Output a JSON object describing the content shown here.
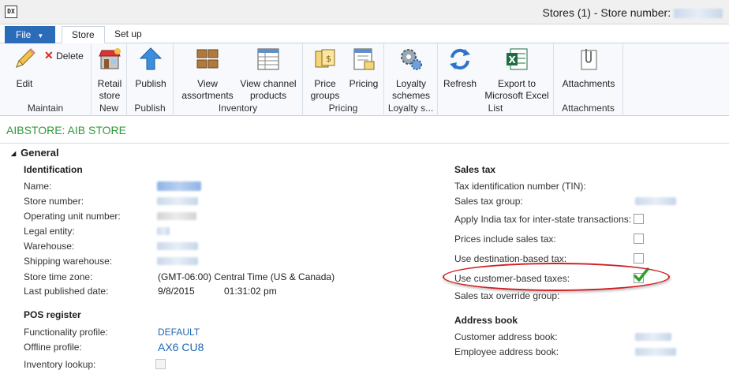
{
  "window": {
    "title": "Stores (1) - Store number:",
    "title_redacted": "AIB STORE"
  },
  "tabs": {
    "file": "File",
    "store": "Store",
    "setup": "Set up"
  },
  "ribbon": {
    "maintain": {
      "label": "Maintain",
      "edit": "Edit",
      "delete": "Delete"
    },
    "new": {
      "label": "New",
      "retail_store": [
        "Retail",
        "store"
      ]
    },
    "publish": {
      "label": "Publish",
      "publish": "Publish"
    },
    "inventory": {
      "label": "Inventory",
      "view_assortments": [
        "View",
        "assortments"
      ],
      "view_channel_products": [
        "View channel",
        "products"
      ]
    },
    "pricing": {
      "label": "Pricing",
      "price_groups": [
        "Price",
        "groups"
      ],
      "pricing": "Pricing"
    },
    "loyalty": {
      "label": "Loyalty s...",
      "loyalty_schemes": [
        "Loyalty",
        "schemes"
      ]
    },
    "list": {
      "label": "List",
      "refresh": "Refresh",
      "export": [
        "Export to",
        "Microsoft Excel"
      ]
    },
    "attachments": {
      "label": "Attachments",
      "attachments": "Attachments"
    }
  },
  "form": {
    "title": "AIBSTORE: AIB STORE",
    "general": "General",
    "identification": {
      "header": "Identification",
      "name": "Name:",
      "store_number": "Store number:",
      "operating_unit": "Operating unit number:",
      "legal_entity": "Legal entity:",
      "warehouse": "Warehouse:",
      "shipping_warehouse": "Shipping warehouse:",
      "time_zone": "Store time zone:",
      "time_zone_value": "(GMT-06:00) Central Time (US & Canada)",
      "last_published": "Last published date:",
      "last_published_date": "9/8/2015",
      "last_published_time": "01:31:02 pm"
    },
    "pos": {
      "header": "POS register",
      "functionality_profile": "Functionality profile:",
      "functionality_profile_value": "DEFAULT",
      "offline_profile": "Offline profile:",
      "offline_profile_value": "AX6 CU8",
      "inventory_lookup": "Inventory lookup:"
    },
    "sales_tax": {
      "header": "Sales tax",
      "tin": "Tax identification number (TIN):",
      "group": "Sales tax group:",
      "india": "Apply India tax for inter-state transactions:",
      "prices_include": "Prices include sales tax:",
      "destination": "Use destination-based tax:",
      "customer": "Use customer-based taxes:",
      "override": "Sales tax override group:"
    },
    "address_book": {
      "header": "Address book",
      "customer": "Customer address book:",
      "employee": "Employee address book:"
    }
  },
  "colors": {
    "accent": "#2b6cb9",
    "title_green": "#2e9a3a",
    "highlight_red": "#d11e22",
    "check_green": "#2ca02c"
  }
}
